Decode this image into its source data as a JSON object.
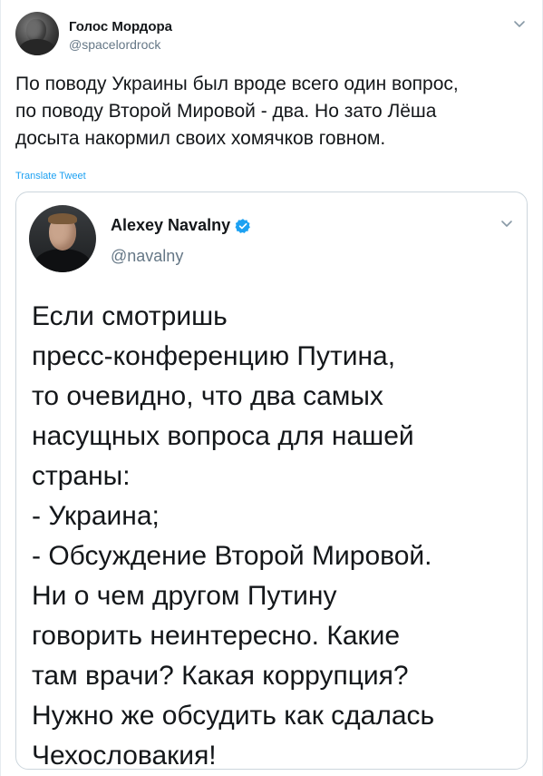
{
  "tweet": {
    "author": {
      "display_name": "Голос Мордора",
      "handle": "@spacelordrock"
    },
    "text": "По поводу Украины был вроде всего один вопрос,\nпо поводу Второй Мировой - два. Но зато Лёша\nдосыта накормил своих хомячков говном.",
    "translate_label": "Translate Tweet",
    "menu_icon": "chevron-down-icon"
  },
  "quoted_tweet": {
    "author": {
      "display_name": "Alexey Navalny",
      "handle": "@navalny",
      "verified": true
    },
    "text": "Если смотришь\nпресс-конференцию Путина,\nто очевидно, что два самых\nнасущных вопроса для нашей\nстраны:\n- Украина;\n- Обсуждение Второй Мировой.\nНи о чем другом Путину\nговорить неинтересно. Какие\nтам врачи? Какая коррупция?\nНужно же обсудить как сдалась\nЧехословакия!",
    "menu_icon": "chevron-down-icon"
  },
  "colors": {
    "link_blue": "#1da1f2",
    "secondary_text": "#657786",
    "primary_text": "#14171a",
    "card_border": "#ccd6dd"
  }
}
